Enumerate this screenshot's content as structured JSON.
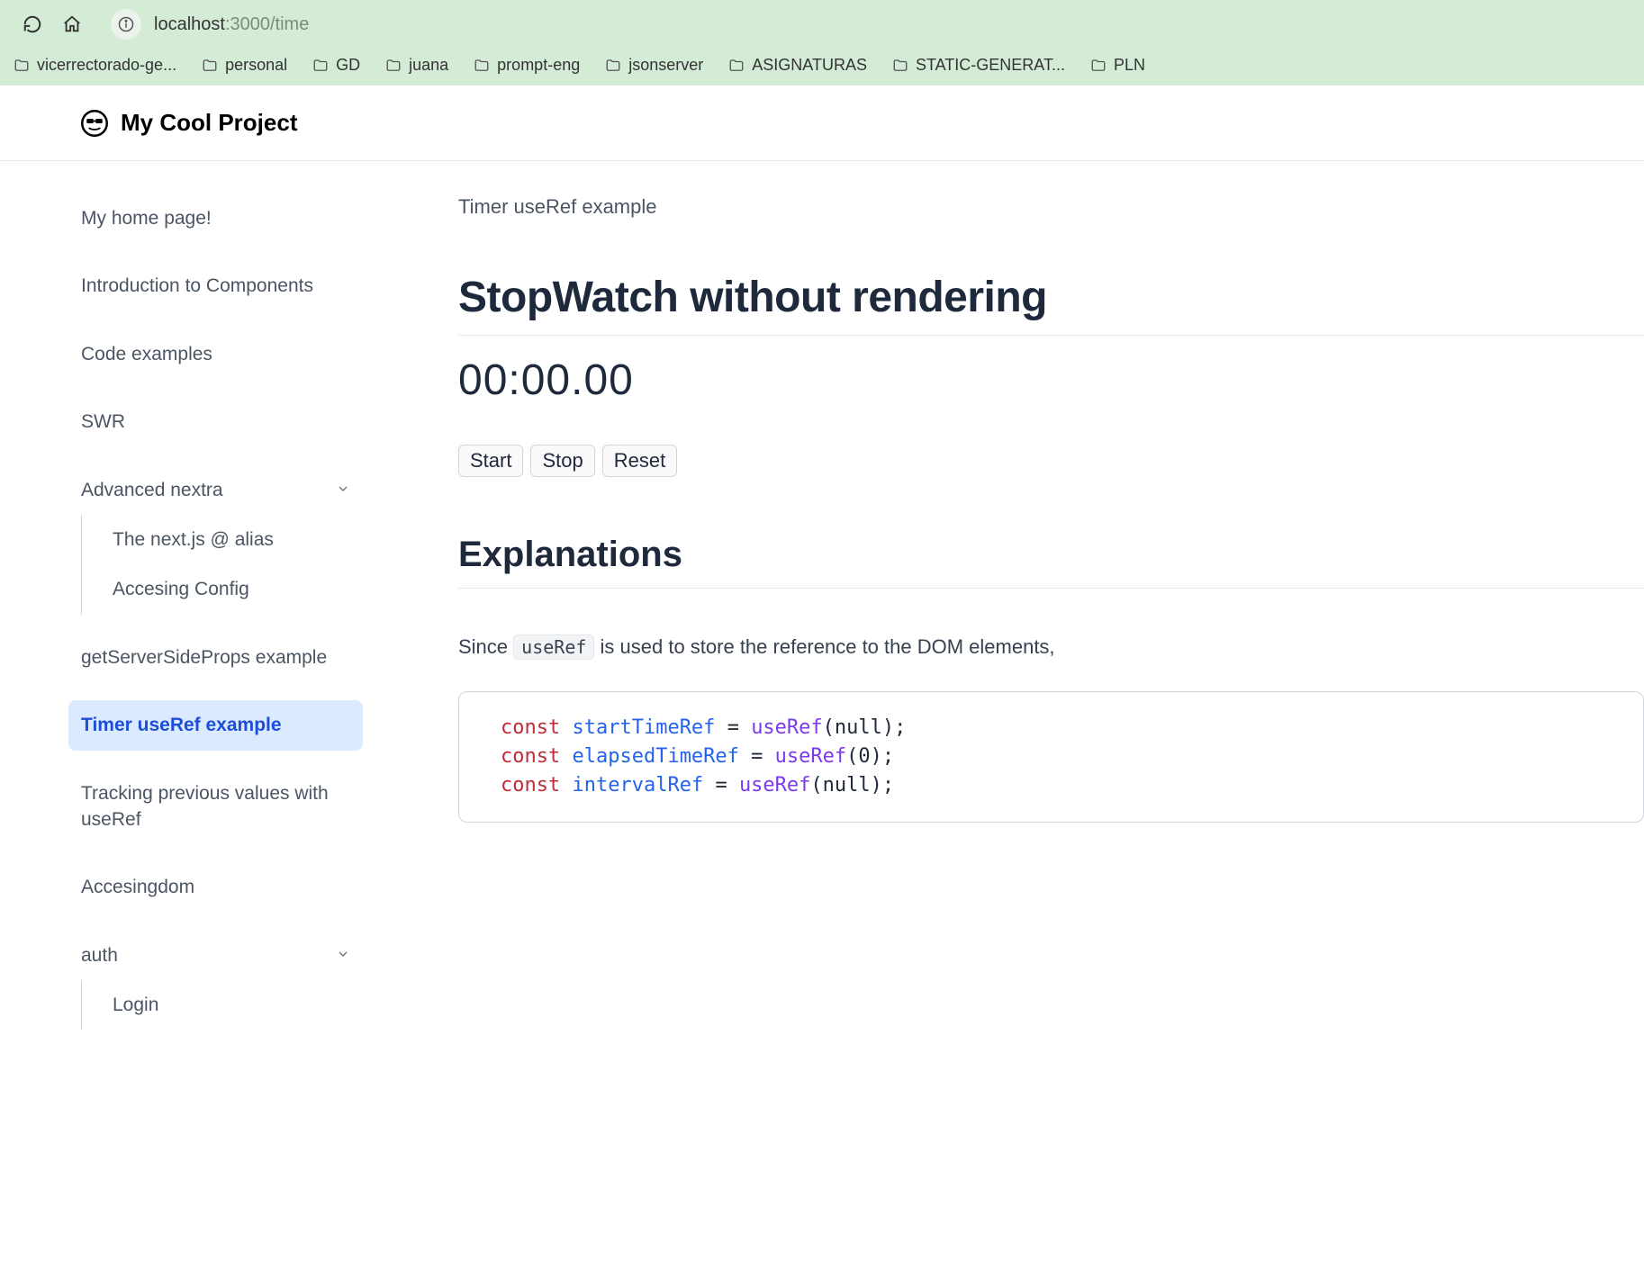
{
  "browser": {
    "url_host": "localhost",
    "url_port_path": ":3000/time",
    "bookmarks": [
      "vicerrectorado-ge...",
      "personal",
      "GD",
      "juana",
      "prompt-eng",
      "jsonserver",
      "ASIGNATURAS",
      "STATIC-GENERAT...",
      "PLN"
    ]
  },
  "header": {
    "title": "My Cool Project"
  },
  "sidebar": {
    "items": [
      {
        "label": "My home page!",
        "active": false
      },
      {
        "label": "Introduction to Components",
        "active": false
      },
      {
        "label": "Code examples",
        "active": false
      },
      {
        "label": "SWR",
        "active": false
      },
      {
        "label": "Advanced nextra",
        "active": false,
        "expandable": true,
        "children": [
          {
            "label": "The next.js @ alias"
          },
          {
            "label": "Accesing Config"
          }
        ]
      },
      {
        "label": "getServerSideProps example",
        "active": false
      },
      {
        "label": "Timer useRef example",
        "active": true
      },
      {
        "label": "Tracking previous values with useRef",
        "active": false
      },
      {
        "label": "Accesingdom",
        "active": false
      },
      {
        "label": "auth",
        "active": false,
        "expandable": true,
        "children": [
          {
            "label": "Login"
          }
        ]
      }
    ]
  },
  "main": {
    "breadcrumb": "Timer useRef example",
    "h1": "StopWatch without rendering",
    "stopwatch_value": "00:00.00",
    "buttons": {
      "start": "Start",
      "stop": "Stop",
      "reset": "Reset"
    },
    "h2": "Explanations",
    "para_prefix": "Since ",
    "inline_code": "useRef",
    "para_suffix": " is used to store the reference to the DOM elements,",
    "code": [
      {
        "kw": "const",
        "id": "startTimeRef",
        "eq": "=",
        "fn": "useRef",
        "arg": "null",
        "tail": ");"
      },
      {
        "kw": "const",
        "id": "elapsedTimeRef",
        "eq": "=",
        "fn": "useRef",
        "arg": "0",
        "tail": ");"
      },
      {
        "kw": "const",
        "id": "intervalRef",
        "eq": "=",
        "fn": "useRef",
        "arg": "null",
        "tail": ");"
      }
    ]
  }
}
